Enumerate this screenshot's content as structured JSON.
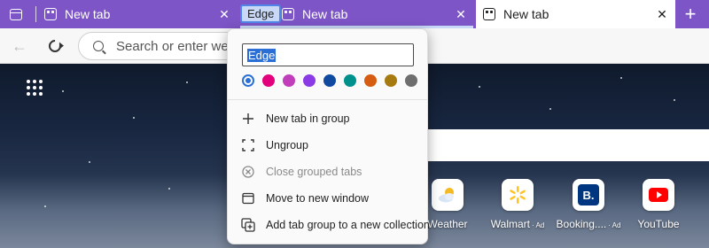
{
  "tabs": [
    {
      "title": "New tab",
      "close": "✕"
    },
    {
      "title": "New tab",
      "close": "✕"
    },
    {
      "title": "New tab",
      "close": "✕"
    }
  ],
  "group": {
    "name": "Edge"
  },
  "new_tab_symbol": "+",
  "toolbar": {
    "back_symbol": "←",
    "omnibox_placeholder": "Search or enter web a"
  },
  "menu": {
    "name_value": "Edge",
    "colors": [
      "#ffffff",
      "#e3007d",
      "#c13eba",
      "#8a3be6",
      "#0f4aa0",
      "#00918c",
      "#d55c10",
      "#a67a0e",
      "#6e6e6e"
    ],
    "items": [
      {
        "label": "New tab in group",
        "icon": "plus-icon",
        "glyph": "+"
      },
      {
        "label": "Ungroup",
        "icon": "ungroup-icon",
        "glyph": "⛶"
      },
      {
        "label": "Close grouped tabs",
        "icon": "close-circle-icon",
        "glyph": "⊗"
      },
      {
        "label": "Move to new window",
        "icon": "window-icon",
        "glyph": "▭"
      },
      {
        "label": "Add tab group to a new collection",
        "icon": "collection-add-icon",
        "glyph": "⧉"
      }
    ]
  },
  "quick_links": [
    {
      "label": "Weather",
      "ad": "",
      "icon": "weather-icon"
    },
    {
      "label": "Walmart",
      "ad": "· Ad",
      "icon": "walmart-icon"
    },
    {
      "label": "Booking....",
      "ad": "· Ad",
      "icon": "booking-icon"
    },
    {
      "label": "YouTube",
      "ad": "",
      "icon": "youtube-icon"
    }
  ],
  "booking_letter": "B."
}
